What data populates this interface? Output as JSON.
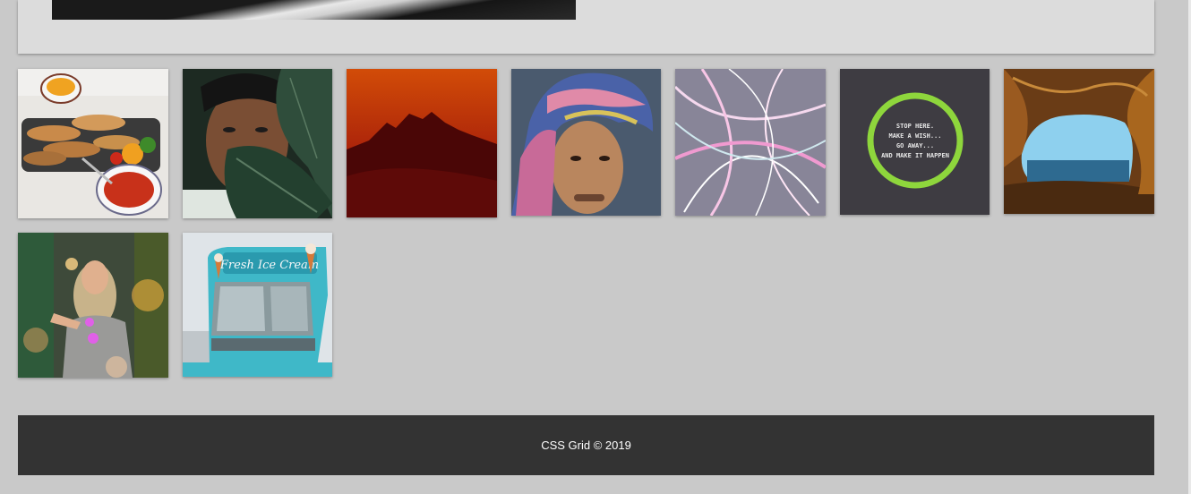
{
  "header_card": {
    "image_name": "hero-image"
  },
  "gallery": {
    "tiles": [
      {
        "name": "gallery-image-tacos"
      },
      {
        "name": "gallery-image-woman-leaf"
      },
      {
        "name": "gallery-image-red-desert"
      },
      {
        "name": "gallery-image-man-headscarf"
      },
      {
        "name": "gallery-image-light-trails"
      },
      {
        "name": "gallery-image-stop-here-sign",
        "text_lines": [
          "STOP HERE.",
          "MAKE A WISH...",
          "GO AWAY...",
          "AND MAKE IT HAPPEN"
        ]
      },
      {
        "name": "gallery-image-sea-cave"
      },
      {
        "name": "gallery-image-woman-sparkler"
      },
      {
        "name": "gallery-image-ice-cream-truck",
        "sign_text": "Fresh Ice Cream"
      }
    ]
  },
  "footer": {
    "text": "CSS Grid © 2019"
  },
  "colors": {
    "background": "#c9c9c9",
    "card": "#dcdcdc",
    "footer": "#333333",
    "footer_text": "#ffffff"
  }
}
